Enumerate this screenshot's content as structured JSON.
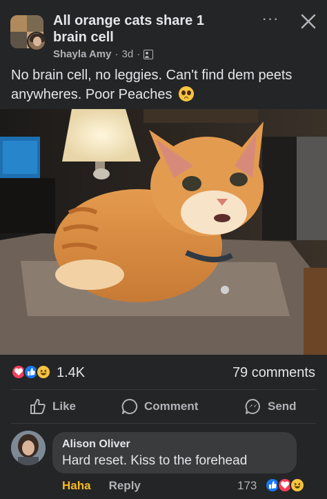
{
  "post": {
    "group_name": "All orange cats share 1 brain cell",
    "author": "Shayla Amy",
    "age": "3d",
    "separator": "·",
    "text": "No brain cell, no leggies. Can't find dem peets anywheres. Poor Peaches",
    "more_glyph": "···"
  },
  "reactions": {
    "types": [
      "love",
      "like",
      "haha"
    ],
    "count": "1.4K",
    "comments": "79 comments"
  },
  "actions": {
    "like": "Like",
    "comment": "Comment",
    "send": "Send"
  },
  "comment": {
    "name": "Alison Oliver",
    "text": "Hard reset. Kiss to the forehead",
    "haha": "Haha",
    "reply": "Reply",
    "reaction_count": "173",
    "reaction_types": [
      "like",
      "love",
      "haha"
    ]
  },
  "colors": {
    "background": "#242526",
    "text": "#e4e6eb",
    "muted": "#b0b3b8",
    "bubble": "#3a3b3c",
    "like_blue": "#1877f2",
    "love_red": "#f33e58",
    "haha_yellow": "#f7c441",
    "haha_label": "#f7b928",
    "cat_orange": "#d98a3e"
  },
  "icons": [
    "group-avatar",
    "close-icon",
    "more-icon",
    "privacy-group-icon",
    "pleading-face-emoji",
    "like-icon",
    "comment-icon",
    "messenger-send-icon"
  ]
}
